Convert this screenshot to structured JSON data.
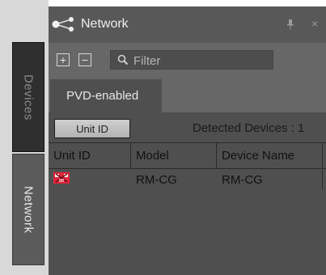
{
  "side_tabs": {
    "devices": "Devices",
    "network": "Network"
  },
  "panel": {
    "title": "Network",
    "icons": {
      "network": "network-share-icon",
      "pin": "pin-icon",
      "close": "close-icon"
    },
    "close_glyph": "×"
  },
  "toolbar": {
    "expand_glyph": "+",
    "collapse_glyph": "−",
    "filter_placeholder": "Filter"
  },
  "tabs": {
    "pvd_enabled": "PVD-enabled"
  },
  "content": {
    "unit_id_button": "Unit ID",
    "detected_devices": "Detected Devices : 1"
  },
  "table": {
    "headers": [
      "Unit ID",
      "Model",
      "Device Name"
    ],
    "rows": [
      {
        "unit_icon": "device-error-icon",
        "model": "RM-CG",
        "device_name": "RM-CG"
      }
    ]
  },
  "colors": {
    "accent_red": "#e0253a",
    "panel_bg": "#4f4f4f",
    "titlebar_bg": "#585858"
  }
}
